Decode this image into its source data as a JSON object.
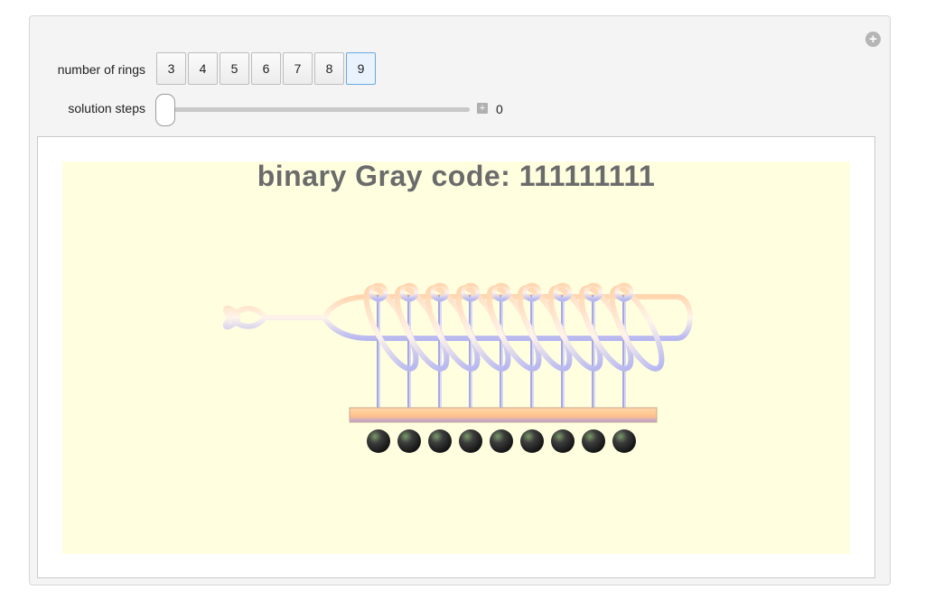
{
  "controls": {
    "rings_label": "number of rings",
    "ring_options": [
      "3",
      "4",
      "5",
      "6",
      "7",
      "8",
      "9"
    ],
    "selected_option": "9",
    "steps_label": "solution steps",
    "steps_value": "0",
    "steps_fraction": 0
  },
  "display": {
    "title_prefix": "binary Gray code: ",
    "gray_code": "111111111",
    "ring_count": 9
  },
  "colors": {
    "canvas_bg": "#ffffe0",
    "selected_button": "#eaf3fd",
    "rod": "#ffc896",
    "ring": "#c8c8ff",
    "ball": "#3a3a3a"
  }
}
